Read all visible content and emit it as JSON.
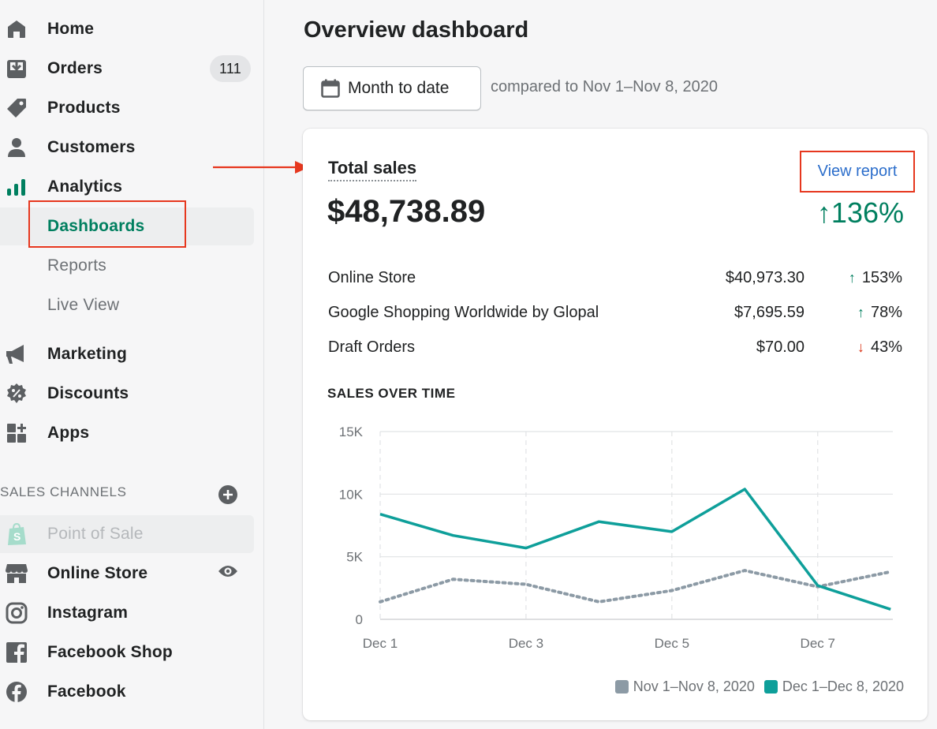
{
  "sidebar": {
    "items": [
      {
        "label": "Home",
        "icon": "home-icon"
      },
      {
        "label": "Orders",
        "icon": "orders-icon",
        "badge": "111"
      },
      {
        "label": "Products",
        "icon": "tag-icon"
      },
      {
        "label": "Customers",
        "icon": "person-icon"
      },
      {
        "label": "Analytics",
        "icon": "bar-chart-icon"
      }
    ],
    "analytics_sub": [
      {
        "label": "Dashboards",
        "active": true
      },
      {
        "label": "Reports"
      },
      {
        "label": "Live View"
      }
    ],
    "items2": [
      {
        "label": "Marketing",
        "icon": "megaphone-icon"
      },
      {
        "label": "Discounts",
        "icon": "discount-icon"
      },
      {
        "label": "Apps",
        "icon": "apps-icon"
      }
    ],
    "sales_channels_title": "SALES CHANNELS",
    "channels": [
      {
        "label": "Point of Sale",
        "icon": "shopify-bag-icon",
        "disabled": true
      },
      {
        "label": "Online Store",
        "icon": "store-icon"
      },
      {
        "label": "Instagram",
        "icon": "instagram-icon"
      },
      {
        "label": "Facebook Shop",
        "icon": "facebook-square-icon"
      },
      {
        "label": "Facebook",
        "icon": "facebook-circle-icon"
      }
    ]
  },
  "main": {
    "title": "Overview dashboard",
    "date_button": "Month to date",
    "compare_text": "compared to Nov 1–Nov 8, 2020"
  },
  "card": {
    "title": "Total sales",
    "view_report": "View report",
    "total": "$48,738.89",
    "total_change": "136%",
    "rows": [
      {
        "name": "Online Store",
        "amount": "$40,973.30",
        "pct": "153%",
        "direction": "up"
      },
      {
        "name": "Google Shopping Worldwide by Glopal",
        "amount": "$7,695.59",
        "pct": "78%",
        "direction": "up"
      },
      {
        "name": "Draft Orders",
        "amount": "$70.00",
        "pct": "43%",
        "direction": "down"
      }
    ],
    "chart_heading": "SALES OVER TIME"
  },
  "colors": {
    "accent_green": "#007f5f",
    "link_blue": "#2c6ecb",
    "annotation_red": "#e6371e",
    "current_series": "#0e9f9a",
    "previous_series": "#8c9aa5"
  },
  "chart_data": {
    "type": "line",
    "x": [
      "Dec 1",
      "Dec 2",
      "Dec 3",
      "Dec 4",
      "Dec 5",
      "Dec 6",
      "Dec 7",
      "Dec 8"
    ],
    "x_tick_labels": [
      "Dec 1",
      "Dec 3",
      "Dec 5",
      "Dec 7"
    ],
    "y_tick_labels": [
      "0",
      "5K",
      "10K",
      "15K"
    ],
    "ylim": [
      0,
      15000
    ],
    "grid": true,
    "legend_position": "bottom-right",
    "series": [
      {
        "name": "Nov 1–Nov 8, 2020",
        "style": "dotted",
        "values": [
          1400,
          3200,
          2800,
          1400,
          2300,
          3900,
          2600,
          3800
        ]
      },
      {
        "name": "Dec 1–Dec 8, 2020",
        "style": "solid",
        "values": [
          8400,
          6700,
          5700,
          7800,
          7000,
          10400,
          2700,
          800
        ]
      }
    ]
  }
}
